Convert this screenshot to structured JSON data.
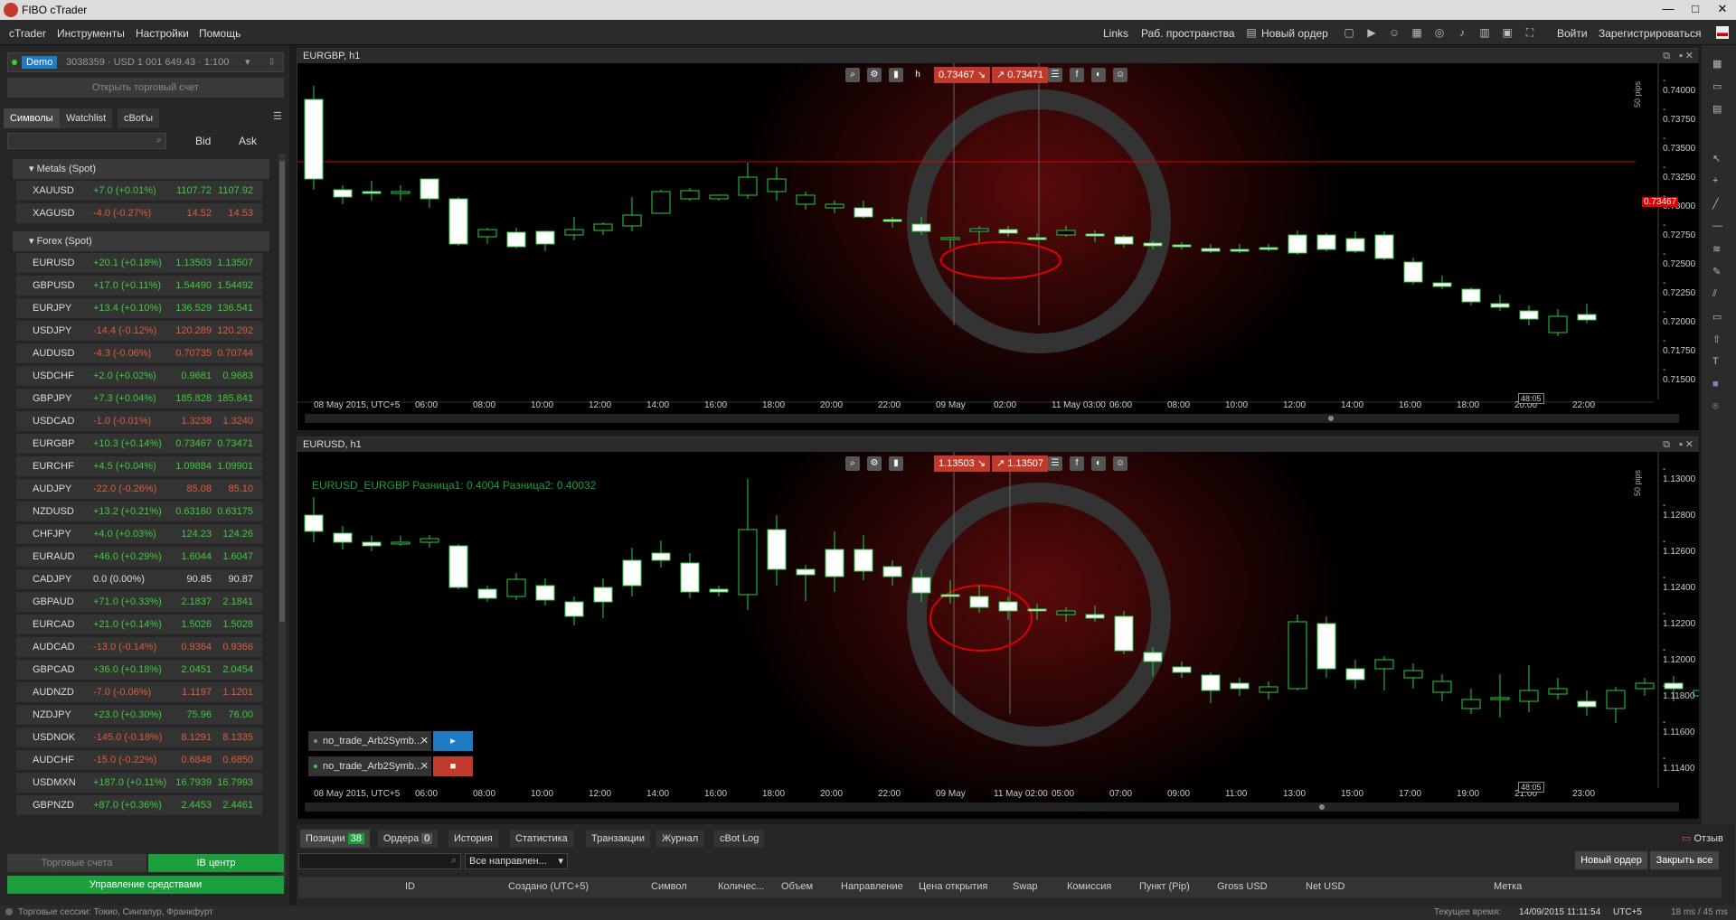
{
  "window": {
    "title": "FIBO cTrader"
  },
  "menu": {
    "items": [
      "cTrader",
      "Инструменты",
      "Настройки",
      "Помощь"
    ],
    "right": [
      "Links",
      "Раб. пространства",
      "Новый ордер",
      "Войти",
      "Зарегистрироваться"
    ]
  },
  "account": {
    "badge": "Demo",
    "text": "3038359 · USD 1 001 649.43 · 1:100",
    "open_btn": "Открыть торговый счет"
  },
  "symbols_panel": {
    "tabs": [
      "Символы",
      "Watchlist",
      "cBot'ы"
    ],
    "bid_label": "Bid",
    "ask_label": "Ask",
    "groups": [
      {
        "name": "Metals (Spot)",
        "rows": [
          {
            "s": "XAUUSD",
            "c": "+7.0 (+0.01%)",
            "d": "up",
            "b": "1107.72",
            "a": "1107.92"
          },
          {
            "s": "XAGUSD",
            "c": "-4.0 (-0.27%)",
            "d": "dn",
            "b": "14.52",
            "a": "14.53"
          }
        ]
      },
      {
        "name": "Forex (Spot)",
        "rows": [
          {
            "s": "EURUSD",
            "c": "+20.1 (+0.18%)",
            "d": "up",
            "b": "1.13503",
            "a": "1.13507"
          },
          {
            "s": "GBPUSD",
            "c": "+17.0 (+0.11%)",
            "d": "up",
            "b": "1.54490",
            "a": "1.54492"
          },
          {
            "s": "EURJPY",
            "c": "+13.4 (+0.10%)",
            "d": "up",
            "b": "136.529",
            "a": "136.541"
          },
          {
            "s": "USDJPY",
            "c": "-14.4 (-0.12%)",
            "d": "dn",
            "b": "120.289",
            "a": "120.292"
          },
          {
            "s": "AUDUSD",
            "c": "-4.3 (-0.06%)",
            "d": "dn",
            "b": "0.70735",
            "a": "0.70744"
          },
          {
            "s": "USDCHF",
            "c": "+2.0 (+0.02%)",
            "d": "up",
            "b": "0.9681",
            "a": "0.9683"
          },
          {
            "s": "GBPJPY",
            "c": "+7.3 (+0.04%)",
            "d": "up",
            "b": "185.828",
            "a": "185.841"
          },
          {
            "s": "USDCAD",
            "c": "-1.0 (-0.01%)",
            "d": "dn",
            "b": "1.3238",
            "a": "1.3240"
          },
          {
            "s": "EURGBP",
            "c": "+10.3 (+0.14%)",
            "d": "up",
            "b": "0.73467",
            "a": "0.73471"
          },
          {
            "s": "EURCHF",
            "c": "+4.5 (+0.04%)",
            "d": "up",
            "b": "1.09884",
            "a": "1.09901"
          },
          {
            "s": "AUDJPY",
            "c": "-22.0 (-0.26%)",
            "d": "dn",
            "b": "85.08",
            "a": "85.10"
          },
          {
            "s": "NZDUSD",
            "c": "+13.2 (+0.21%)",
            "d": "up",
            "b": "0.63160",
            "a": "0.63175"
          },
          {
            "s": "CHFJPY",
            "c": "+4.0 (+0.03%)",
            "d": "up",
            "b": "124.23",
            "a": "124.26"
          },
          {
            "s": "EURAUD",
            "c": "+46.0 (+0.29%)",
            "d": "up",
            "b": "1.6044",
            "a": "1.6047"
          },
          {
            "s": "CADJPY",
            "c": "0.0 (0.00%)",
            "d": "nt",
            "b": "90.85",
            "a": "90.87"
          },
          {
            "s": "GBPAUD",
            "c": "+71.0 (+0.33%)",
            "d": "up",
            "b": "2.1837",
            "a": "2.1841"
          },
          {
            "s": "EURCAD",
            "c": "+21.0 (+0.14%)",
            "d": "up",
            "b": "1.5026",
            "a": "1.5028"
          },
          {
            "s": "AUDCAD",
            "c": "-13.0 (-0.14%)",
            "d": "dn",
            "b": "0.9364",
            "a": "0.9366"
          },
          {
            "s": "GBPCAD",
            "c": "+36.0 (+0.18%)",
            "d": "up",
            "b": "2.0451",
            "a": "2.0454"
          },
          {
            "s": "AUDNZD",
            "c": "-7.0 (-0.06%)",
            "d": "dn",
            "b": "1.1197",
            "a": "1.1201"
          },
          {
            "s": "NZDJPY",
            "c": "+23.0 (+0.30%)",
            "d": "up",
            "b": "75.96",
            "a": "76.00"
          },
          {
            "s": "USDNOK",
            "c": "-145.0 (-0.18%)",
            "d": "dn",
            "b": "8.1291",
            "a": "8.1335"
          },
          {
            "s": "AUDCHF",
            "c": "-15.0 (-0.22%)",
            "d": "dn",
            "b": "0.6848",
            "a": "0.6850"
          },
          {
            "s": "USDMXN",
            "c": "+187.0 (+0.11%)",
            "d": "up",
            "b": "16.7939",
            "a": "16.7993"
          },
          {
            "s": "GBPNZD",
            "c": "+87.0 (+0.36%)",
            "d": "up",
            "b": "2.4453",
            "a": "2.4461"
          }
        ]
      }
    ],
    "bottom_btns": [
      "Торговые счета",
      "IB центр",
      "Управление средствами"
    ]
  },
  "chart1": {
    "title": "EURGBP, h1",
    "bid": "0.73467",
    "ask": "0.73471",
    "current": "0.73467",
    "pips": "50 pips",
    "timer": "48:05",
    "yticks": [
      "0.74000",
      "0.73750",
      "0.73500",
      "0.73250",
      "0.73000",
      "0.72750",
      "0.72500",
      "0.72250",
      "0.72000",
      "0.71750",
      "0.71500"
    ],
    "xticks": [
      "08 May 2015, UTC+5",
      "06:00",
      "08:00",
      "10:00",
      "12:00",
      "14:00",
      "16:00",
      "18:00",
      "20:00",
      "22:00",
      "09 May",
      "02:00",
      "11 May 03:00",
      "06:00",
      "08:00",
      "10:00",
      "12:00",
      "14:00",
      "16:00",
      "18:00",
      "20:00",
      "22:00"
    ]
  },
  "chart2": {
    "title": "EURUSD, h1",
    "bid": "1.13503",
    "ask": "1.13507",
    "pips": "50 pips",
    "timer": "48:05",
    "indicator": "EURUSD_EURGBP Разница1: 0.4004 Разница2: 0.40032",
    "yticks": [
      "1.13000",
      "1.12800",
      "1.12600",
      "1.12400",
      "1.12200",
      "1.12000",
      "1.11800",
      "1.11600",
      "1.11400"
    ],
    "xticks": [
      "08 May 2015, UTC+5",
      "06:00",
      "08:00",
      "10:00",
      "12:00",
      "14:00",
      "16:00",
      "18:00",
      "20:00",
      "22:00",
      "09 May",
      "11 May 02:00",
      "05:00",
      "07:00",
      "09:00",
      "11:00",
      "13:00",
      "15:00",
      "17:00",
      "19:00",
      "21:00",
      "23:00"
    ],
    "bots": [
      "no_trade_Arb2Symb...",
      "no_trade_Arb2Symb..."
    ]
  },
  "bottom_panel": {
    "tabs": [
      "Позиции",
      "Ордера",
      "История",
      "Статистика",
      "Транзакции",
      "Журнал",
      "cBot Log"
    ],
    "positions_count": "38",
    "orders_count": "0",
    "collapse": "Отзыв",
    "direction": "Все направлен...",
    "new_order": "Новый ордер",
    "close_all": "Закрыть все",
    "columns": [
      "ID",
      "Создано (UTC+5)",
      "Символ",
      "Количес...",
      "Объем",
      "Направление",
      "Цена открытия",
      "Swap",
      "Комиссия",
      "Пункт (Pip)",
      "Gross USD",
      "Net USD",
      "Метка"
    ]
  },
  "status": {
    "sessions": "Торговые сессии:  Токио, Сингапур, Франкфурт",
    "time_label": "Текущее время:",
    "time": "14/09/2015 11:11:54",
    "tz": "UTC+5",
    "latency": "18 ms / 45 ms"
  },
  "colors": {
    "up": "#3fcb3f",
    "down": "#e05d3d",
    "sell": "#c0392b",
    "green": "#1a9f3c",
    "blue": "#1e7bc4"
  }
}
